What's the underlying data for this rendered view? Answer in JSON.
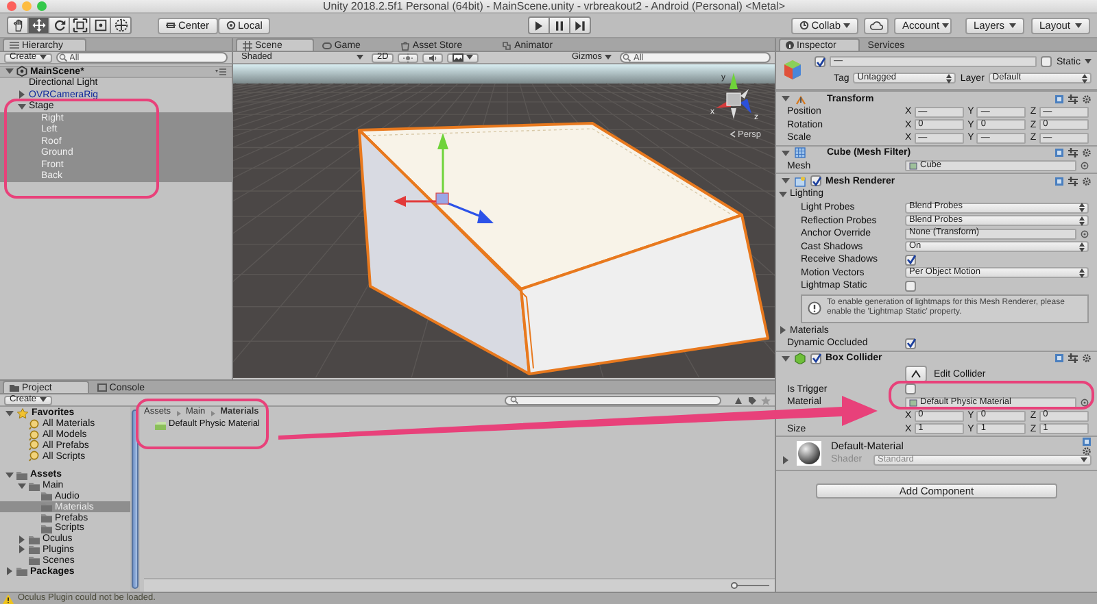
{
  "window": {
    "title": "Unity 2018.2.5f1 Personal (64bit) - MainScene.unity - vrbreakout2 - Android (Personal) <Metal>"
  },
  "toolbar": {
    "tools": [
      {
        "kind": "hand",
        "selected": false
      },
      {
        "kind": "move",
        "selected": true
      },
      {
        "kind": "rotate",
        "selected": false
      },
      {
        "kind": "scale",
        "selected": false
      },
      {
        "kind": "rect",
        "selected": false
      },
      {
        "kind": "transform",
        "selected": false
      }
    ],
    "pivot": [
      {
        "kind": "center",
        "label": "Center"
      },
      {
        "kind": "local",
        "label": "Local"
      }
    ],
    "playback": [
      {
        "kind": "play"
      },
      {
        "kind": "pause"
      },
      {
        "kind": "step"
      }
    ],
    "collab": {
      "label": "Collab"
    },
    "account": {
      "label": "Account"
    },
    "layers": {
      "label": "Layers"
    },
    "layout": {
      "label": "Layout"
    }
  },
  "hierarchy": {
    "tab": "Hierarchy",
    "create": "Create",
    "search": {
      "placeholder": "All"
    },
    "tree": [
      {
        "label": "MainScene*",
        "kind": "scene",
        "expanded": true,
        "selected": false,
        "children": [
          {
            "label": "Directional Light",
            "kind": "object",
            "selected": false
          },
          {
            "label": "OVRCameraRig",
            "kind": "prefab",
            "expanded": false,
            "selected": false
          },
          {
            "label": "Stage",
            "kind": "object",
            "expanded": true,
            "selected": false,
            "children": [
              {
                "label": "Right",
                "kind": "object",
                "selected": true
              },
              {
                "label": "Left",
                "kind": "object",
                "selected": true
              },
              {
                "label": "Roof",
                "kind": "object",
                "selected": true
              },
              {
                "label": "Ground",
                "kind": "object",
                "selected": true
              },
              {
                "label": "Front",
                "kind": "object",
                "selected": true
              },
              {
                "label": "Back",
                "kind": "object",
                "selected": true
              }
            ]
          }
        ]
      }
    ]
  },
  "scene": {
    "tabs": [
      {
        "kind": "scene",
        "label": "Scene",
        "selected": true
      },
      {
        "kind": "game",
        "label": "Game",
        "selected": false
      },
      {
        "kind": "store",
        "label": "Asset Store",
        "selected": false
      },
      {
        "kind": "animator",
        "label": "Animator",
        "selected": false
      }
    ],
    "shading": "Shaded",
    "mode_2d": "2D",
    "gizmos": "Gizmos",
    "search": {
      "placeholder": "All"
    },
    "projection": "Persp",
    "axis_labels": [
      "y",
      "x",
      "z"
    ]
  },
  "inspector": {
    "tabs": [
      {
        "label": "Inspector",
        "selected": true
      },
      {
        "label": "Services",
        "selected": false
      }
    ],
    "object": {
      "active": true,
      "name": "—",
      "static": {
        "label": "Static",
        "checked": false
      },
      "tag": {
        "label": "Tag",
        "value": "Untagged"
      },
      "layer": {
        "label": "Layer",
        "value": "Default"
      }
    },
    "components": [
      {
        "kind": "transform",
        "title": "Transform",
        "expanded": true,
        "rows": [
          {
            "kind": "vector3",
            "label": "Position",
            "values": [
              {
                "axis": "X",
                "value": "—"
              },
              {
                "axis": "Y",
                "value": "—"
              },
              {
                "axis": "Z",
                "value": "—"
              }
            ]
          },
          {
            "kind": "vector3",
            "label": "Rotation",
            "values": [
              {
                "axis": "X",
                "value": "0"
              },
              {
                "axis": "Y",
                "value": "0"
              },
              {
                "axis": "Z",
                "value": "0"
              }
            ]
          },
          {
            "kind": "vector3",
            "label": "Scale",
            "values": [
              {
                "axis": "X",
                "value": "—"
              },
              {
                "axis": "Y",
                "value": "—"
              },
              {
                "axis": "Z",
                "value": "—"
              }
            ]
          }
        ]
      },
      {
        "kind": "mesh_filter",
        "title": "Cube (Mesh Filter)",
        "expanded": true,
        "rows": [
          {
            "kind": "object",
            "label": "Mesh",
            "value": "Cube"
          }
        ]
      },
      {
        "kind": "mesh_renderer",
        "title": "Mesh Renderer",
        "expanded": true,
        "enabled": true,
        "rows": [
          {
            "kind": "foldout",
            "label": "Lighting",
            "expanded": true,
            "children": [
              {
                "kind": "dropdown",
                "label": "Light Probes",
                "value": "Blend Probes"
              },
              {
                "kind": "dropdown",
                "label": "Reflection Probes",
                "value": "Blend Probes"
              },
              {
                "kind": "object",
                "label": "Anchor Override",
                "value": "None (Transform)"
              },
              {
                "kind": "dropdown",
                "label": "Cast Shadows",
                "value": "On"
              },
              {
                "kind": "checkbox",
                "label": "Receive Shadows",
                "checked": true
              },
              {
                "kind": "dropdown",
                "label": "Motion Vectors",
                "value": "Per Object Motion"
              },
              {
                "kind": "checkbox",
                "label": "Lightmap Static",
                "checked": false
              },
              {
                "kind": "info",
                "text": "To enable generation of lightmaps for this Mesh Renderer, please enable the 'Lightmap Static' property."
              }
            ]
          },
          {
            "kind": "foldout",
            "label": "Materials",
            "expanded": false
          },
          {
            "kind": "checkbox",
            "label": "Dynamic Occluded",
            "checked": true
          }
        ]
      },
      {
        "kind": "box_collider",
        "title": "Box Collider",
        "expanded": true,
        "enabled": true,
        "rows": [
          {
            "kind": "button",
            "label": "Edit Collider"
          },
          {
            "kind": "checkbox",
            "label": "Is Trigger",
            "checked": false
          },
          {
            "kind": "object",
            "label": "Material",
            "value": "Default Physic Material"
          },
          {
            "kind": "vector3",
            "values": [
              {
                "axis": "X",
                "value": "0"
              },
              {
                "axis": "Y",
                "value": "0"
              },
              {
                "axis": "Z",
                "value": "0"
              }
            ]
          },
          {
            "kind": "vector3",
            "label": "Size",
            "values": [
              {
                "axis": "X",
                "value": "1"
              },
              {
                "axis": "Y",
                "value": "1"
              },
              {
                "axis": "Z",
                "value": "1"
              }
            ]
          }
        ]
      },
      {
        "kind": "material",
        "title": "Default-Material",
        "expanded": false,
        "shader_label": "Shader",
        "shader": "Standard"
      }
    ],
    "add_component": "Add Component"
  },
  "project": {
    "tabs": [
      {
        "kind": "project",
        "label": "Project",
        "selected": true
      },
      {
        "kind": "console",
        "label": "Console",
        "selected": false
      }
    ],
    "create": "Create",
    "tree": [
      {
        "label": "Favorites",
        "kind": "favorites",
        "expanded": true,
        "selected": false,
        "children": [
          {
            "label": "All Materials",
            "kind": "search",
            "selected": false
          },
          {
            "label": "All Models",
            "kind": "search",
            "selected": false
          },
          {
            "label": "All Prefabs",
            "kind": "search",
            "selected": false
          },
          {
            "label": "All Scripts",
            "kind": "search",
            "selected": false
          }
        ]
      },
      {
        "label": "Assets",
        "kind": "folder",
        "expanded": true,
        "selected": false,
        "children": [
          {
            "label": "Main",
            "kind": "folder",
            "expanded": true,
            "selected": false,
            "children": [
              {
                "label": "Audio",
                "kind": "folder",
                "selected": false
              },
              {
                "label": "Materials",
                "kind": "folder",
                "selected": true
              },
              {
                "label": "Prefabs",
                "kind": "folder",
                "selected": false
              },
              {
                "label": "Scripts",
                "kind": "folder",
                "selected": false
              }
            ]
          },
          {
            "label": "Oculus",
            "kind": "folder",
            "expanded": false,
            "selected": false
          },
          {
            "label": "Plugins",
            "kind": "folder",
            "expanded": false,
            "selected": false
          },
          {
            "label": "Scenes",
            "kind": "folder",
            "selected": false
          }
        ]
      },
      {
        "label": "Packages",
        "kind": "folder",
        "expanded": false,
        "selected": false
      }
    ],
    "breadcrumb": [
      "Assets",
      "Main",
      "Materials"
    ],
    "items": [
      {
        "label": "Default Physic Material"
      }
    ],
    "icon_size": {
      "level": 0
    }
  },
  "status_bar": {
    "message": "Oculus Plugin could not be loaded."
  }
}
